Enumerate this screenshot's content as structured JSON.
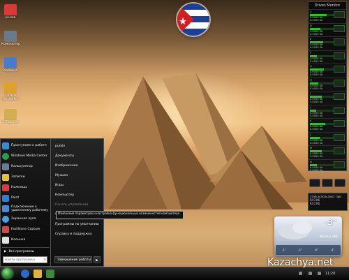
{
  "desktop": {
    "icons": [
      {
        "label": "ps.exe",
        "color": "#d83a3a"
      },
      {
        "label": "Компьютер",
        "color": "#6a7a8a"
      },
      {
        "label": "Корзина",
        "color": "#4a7acc"
      },
      {
        "label": "Сеть и Интернет",
        "color": "#e0a030"
      },
      {
        "label": "R Explorer",
        "color": "#d0b050"
      },
      {
        "label": "",
        "color": "#5080c0"
      }
    ]
  },
  "flag": {
    "colors": {
      "blue": "#1d3f9a",
      "white": "#ffffff",
      "red": "#cf2121"
    }
  },
  "drives_monitor": {
    "title": "Drives Monitor",
    "drives": [
      {
        "letter": "C",
        "fill": 0.7,
        "read": "0.0000 Kb",
        "write": "0.0000 Kb"
      },
      {
        "letter": "D",
        "fill": 0.45,
        "read": "0.0000 Kb",
        "write": "0.0000 Kb"
      },
      {
        "letter": "E",
        "fill": 0.55,
        "read": "0.0000 Kb",
        "write": "0.0000 Kb"
      },
      {
        "letter": "F",
        "fill": 0.3,
        "read": "0.0000 Kb",
        "write": "0.0000 Kb"
      },
      {
        "letter": "G",
        "fill": 0.6,
        "read": "0.0000 Kb",
        "write": "0.0000 Kb"
      },
      {
        "letter": "H",
        "fill": 0.35,
        "read": "0.0000 Kb",
        "write": "0.0000 Kb"
      },
      {
        "letter": "I",
        "fill": 0.5,
        "read": "0.0000 Kb",
        "write": "0.0000 Kb"
      },
      {
        "letter": "J",
        "fill": 0.25,
        "read": "0.0000 Kb",
        "write": "0.0000 Kb"
      },
      {
        "letter": "K",
        "fill": 0.65,
        "read": "0.0000 Kb",
        "write": "0.0000 Kb"
      },
      {
        "letter": "L",
        "fill": 0.4,
        "read": "0.0000 Kb",
        "write": "0.0000 Kb"
      },
      {
        "letter": "M",
        "fill": 0.5,
        "read": "0.0000 Kb",
        "write": "0.0000 Kb"
      },
      {
        "letter": "N",
        "fill": 0.3,
        "read": "0.0000 Kb",
        "write": "0.0000 Kb"
      }
    ]
  },
  "cpu_gadget": {
    "line1": "этой используют при",
    "line2": "RI   0 K6",
    "line3": "RI   0 K6"
  },
  "weather": {
    "temp": "-3°",
    "city": "Москва, UKR",
    "forecast": [
      "-3°",
      "-5°",
      "-6°",
      "-4°"
    ]
  },
  "start_menu": {
    "left_items": [
      {
        "label": "Приступаем к работе",
        "color": "#3a8ad0"
      },
      {
        "label": "Windows Media Center",
        "color": "#2a9a4a"
      },
      {
        "label": "Калькулятор",
        "color": "#6a7a9a"
      },
      {
        "label": "Записки",
        "color": "#e0c040"
      },
      {
        "label": "Ножницы",
        "color": "#d04040"
      },
      {
        "label": "Paint",
        "color": "#3a7ad0"
      },
      {
        "label": "Подключение к удаленному рабочему",
        "color": "#4a8ad0"
      },
      {
        "label": "Экранная лупа",
        "color": "#4aa0e0"
      },
      {
        "label": "FastStone Capture",
        "color": "#c05050"
      },
      {
        "label": "Косынка",
        "color": "#e0e0e0"
      }
    ],
    "all_programs": "Все программы",
    "search_placeholder": "Найти программы",
    "right_items": [
      {
        "label": "pumle",
        "dim": false
      },
      {
        "label": "Документы",
        "dim": false
      },
      {
        "label": "Изображения",
        "dim": false
      },
      {
        "label": "Музыка",
        "dim": false
      },
      {
        "label": "Игры",
        "dim": false
      },
      {
        "label": "Компьютер",
        "dim": false
      },
      {
        "label": "Панель управления",
        "dim": true
      },
      {
        "label": "Устройства и",
        "dim": false
      },
      {
        "label": "Программы по умолчанию",
        "dim": false
      },
      {
        "label": "Справка и поддержка",
        "dim": false
      }
    ],
    "shutdown": "Завершение работы",
    "tooltip": "Изменение параметров и настройка функциональных возможностей компьютера."
  },
  "taskbar": {
    "clock": "11:20"
  },
  "watermark": "Kazachya.net"
}
